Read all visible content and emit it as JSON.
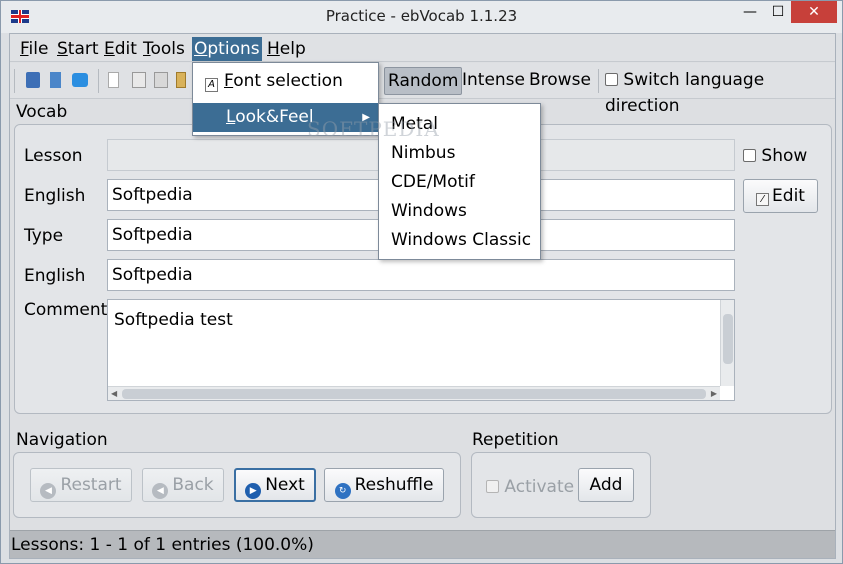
{
  "window": {
    "title": "Practice - ebVocab 1.1.23",
    "minimize": "—",
    "maximize": "☐",
    "close": "✕"
  },
  "menubar": {
    "file": {
      "pre": "",
      "u": "F",
      "post": "ile"
    },
    "start": {
      "pre": "",
      "u": "S",
      "post": "tart"
    },
    "edit": {
      "pre": "",
      "u": "E",
      "post": "dit"
    },
    "tools": {
      "pre": "",
      "u": "T",
      "post": "ools"
    },
    "options": {
      "pre": "",
      "u": "O",
      "post": "ptions"
    },
    "help": {
      "pre": "",
      "u": "H",
      "post": "elp"
    }
  },
  "toolbar": {
    "random": "Random",
    "intense": "Intense",
    "browse": "Browse",
    "switch_language": "Switch language direction"
  },
  "options_menu": {
    "font_selection": {
      "u": "F",
      "rest": "ont selection"
    },
    "look_feel": {
      "u": "L",
      "rest": "ook&Feel"
    }
  },
  "lookfeel_menu": [
    "Metal",
    "Nimbus",
    "CDE/Motif",
    "Windows",
    "Windows Classic"
  ],
  "vocab": {
    "group_label": "Vocab",
    "lesson_label": "Lesson",
    "lesson_value": "",
    "english1_label": "English",
    "english1_value": "Softpedia",
    "type_label": "Type",
    "type_value": "Softpedia",
    "english2_label": "English",
    "english2_value": "Softpedia",
    "comment_label": "Comment",
    "comment_value": "Softpedia test",
    "show_label": "Show",
    "edit_label": "Edit"
  },
  "navigation": {
    "group_label": "Navigation",
    "restart": "Restart",
    "back": "Back",
    "next": "Next",
    "reshuffle": "Reshuffle"
  },
  "repetition": {
    "group_label": "Repetition",
    "activate": "Activate",
    "add": "Add"
  },
  "status": {
    "text": "Lessons: 1 - 1 of 1 entries (100.0%)"
  },
  "watermark": "SOFTPEDIA",
  "colors": {
    "accent": "#3c6d94",
    "close_button": "#c7403a",
    "focus_border": "#3a6fa3"
  }
}
